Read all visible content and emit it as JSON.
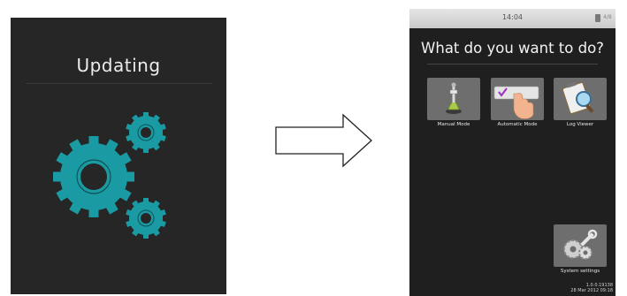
{
  "left_screen": {
    "title": "Updating"
  },
  "right_screen": {
    "clock": "14:04",
    "status_text": "4/8",
    "question": "What do you want to do?",
    "tiles": [
      {
        "label": "Manual Mode",
        "icon": "joystick-icon"
      },
      {
        "label": "Automatic Mode",
        "icon": "hand-pointer-checkbox-icon"
      },
      {
        "label": "Log Viewer",
        "icon": "clipboard-magnifier-icon"
      },
      {
        "label": "System settings",
        "icon": "gears-wrench-icon"
      }
    ],
    "version_line1": "1.0.0.19138",
    "version_line2": "28 Mar 2012 09:18"
  },
  "colors": {
    "gear_teal": "#1a9aa3",
    "screen_dark": "#262626"
  }
}
